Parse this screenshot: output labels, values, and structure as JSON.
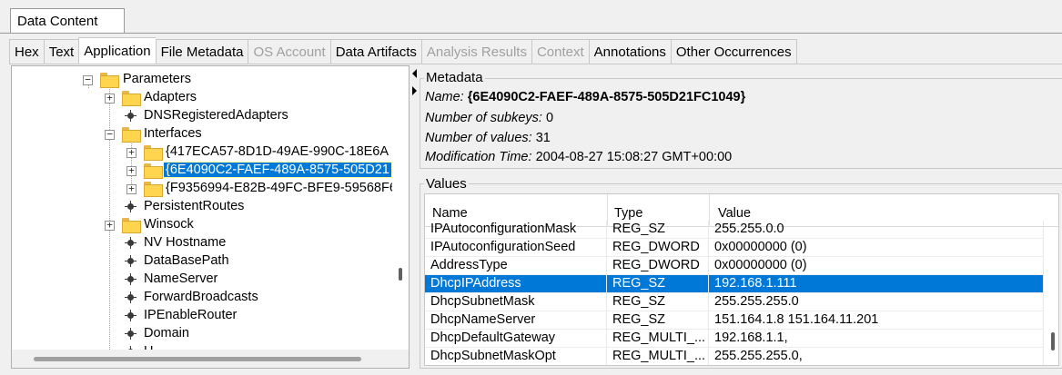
{
  "panel_title": "Data Content",
  "tabs": [
    {
      "label": "Hex",
      "state": "normal"
    },
    {
      "label": "Text",
      "state": "normal"
    },
    {
      "label": "Application",
      "state": "active"
    },
    {
      "label": "File Metadata",
      "state": "normal"
    },
    {
      "label": "OS Account",
      "state": "disabled"
    },
    {
      "label": "Data Artifacts",
      "state": "normal"
    },
    {
      "label": "Analysis Results",
      "state": "disabled"
    },
    {
      "label": "Context",
      "state": "disabled"
    },
    {
      "label": "Annotations",
      "state": "normal"
    },
    {
      "label": "Other Occurrences",
      "state": "normal"
    }
  ],
  "tree": {
    "parameters": "Parameters",
    "adapters": "Adapters",
    "dns_registered_adapters": "DNSRegisteredAdapters",
    "interfaces": "Interfaces",
    "iface_1": "{417ECA57-8D1D-49AE-990C-18E6A",
    "iface_2": "{6E4090C2-FAEF-489A-8575-505D21",
    "iface_3": "{F9356994-E82B-49FC-BFE9-59568F6",
    "persistent_routes": "PersistentRoutes",
    "winsock": "Winsock",
    "nv_hostname": "NV Hostname",
    "database_path": "DataBasePath",
    "name_server": "NameServer",
    "forward_broadcasts": "ForwardBroadcasts",
    "ip_enable_router": "IPEnableRouter",
    "domain": "Domain",
    "partial": "H"
  },
  "metadata": {
    "group_title": "Metadata",
    "name_label": "Name:",
    "name_value": "{6E4090C2-FAEF-489A-8575-505D21FC1049}",
    "subkeys_label": "Number of subkeys:",
    "subkeys_value": "0",
    "values_label": "Number of values:",
    "values_value": "31",
    "modtime_label": "Modification Time:",
    "modtime_value": "2004-08-27 15:08:27 GMT+00:00"
  },
  "values": {
    "group_title": "Values",
    "columns": [
      "Name",
      "Type",
      "Value"
    ],
    "rows": [
      {
        "name": "IPAutoconfigurationMask",
        "type": "REG_SZ",
        "value": "255.255.0.0"
      },
      {
        "name": "IPAutoconfigurationSeed",
        "type": "REG_DWORD",
        "value": "0x00000000 (0)"
      },
      {
        "name": "AddressType",
        "type": "REG_DWORD",
        "value": "0x00000000 (0)"
      },
      {
        "name": "DhcpIPAddress",
        "type": "REG_SZ",
        "value": "192.168.1.111"
      },
      {
        "name": "DhcpSubnetMask",
        "type": "REG_SZ",
        "value": "255.255.255.0"
      },
      {
        "name": "DhcpNameServer",
        "type": "REG_SZ",
        "value": "151.164.1.8 151.164.11.201"
      },
      {
        "name": "DhcpDefaultGateway",
        "type": "REG_MULTI_...",
        "value": "192.168.1.1,"
      },
      {
        "name": "DhcpSubnetMaskOpt",
        "type": "REG_MULTI_...",
        "value": "255.255.255.0,"
      }
    ]
  },
  "colors": {
    "selection": "#0078d7",
    "folder": "#ffd54f"
  }
}
